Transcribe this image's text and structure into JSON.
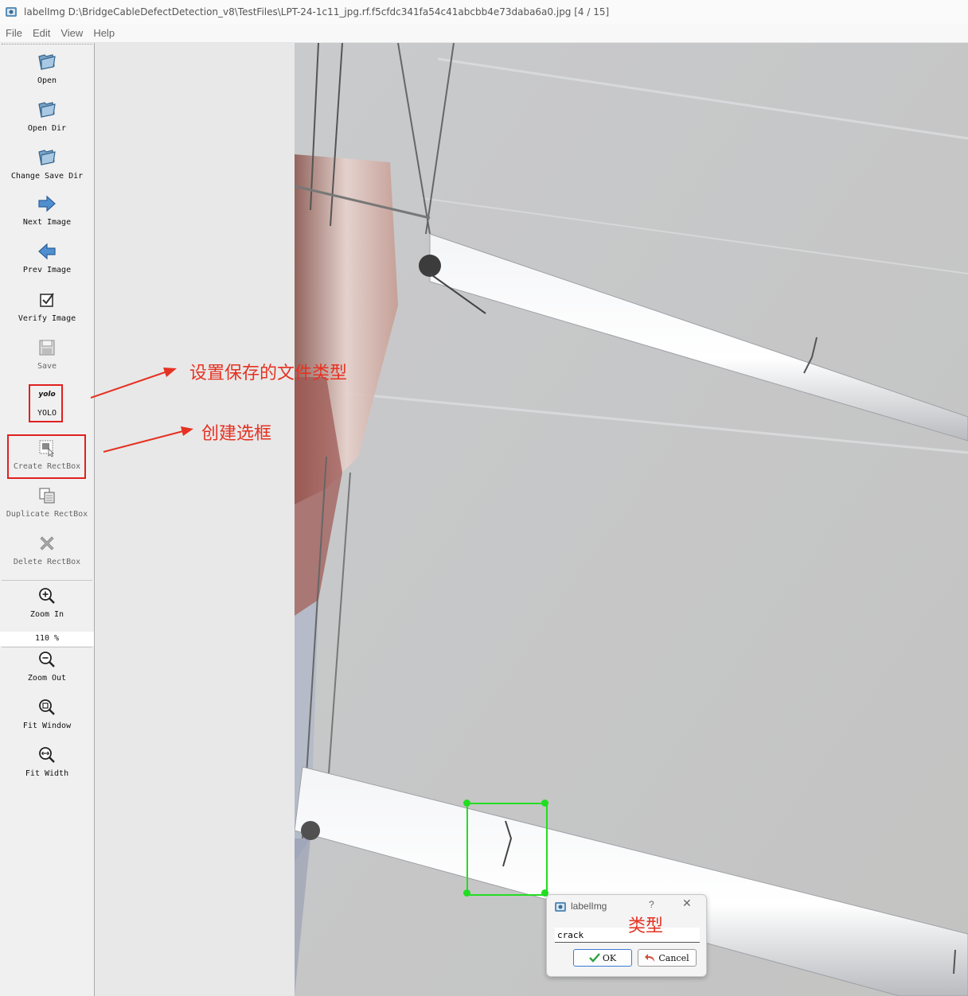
{
  "window": {
    "title": "labelImg D:\\BridgeCableDefectDetection_v8\\TestFiles\\LPT-24-1c11_jpg.rf.f5cfdc341fa54c41abcbb4e73daba6a0.jpg [4 / 15]"
  },
  "menu": [
    "File",
    "Edit",
    "View",
    "Help"
  ],
  "toolbar": {
    "open": "Open",
    "open_dir": "Open Dir",
    "change_save_dir": "Change Save Dir",
    "next_image": "Next Image",
    "prev_image": "Prev Image",
    "verify_image": "Verify Image",
    "save": "Save",
    "format_icon_text": "yolo",
    "format": "YOLO",
    "create_rectbox": "Create RectBox",
    "duplicate_rectbox": "Duplicate RectBox",
    "delete_rectbox": "Delete RectBox",
    "zoom_in": "Zoom In",
    "zoom_value": "110 %",
    "zoom_out": "Zoom Out",
    "fit_window": "Fit Window",
    "fit_width": "Fit Width"
  },
  "annotations": {
    "save_format_note": "设置保存的文件类型",
    "create_box_note": "创建选框",
    "label_type_note": "类型"
  },
  "dialog": {
    "title": "labelImg",
    "help": "?",
    "close": "✕",
    "label_value": "crack",
    "ok": "OK",
    "cancel": "Cancel"
  },
  "colors": {
    "bbox": "#22dd22",
    "annotation": "#e53222"
  }
}
